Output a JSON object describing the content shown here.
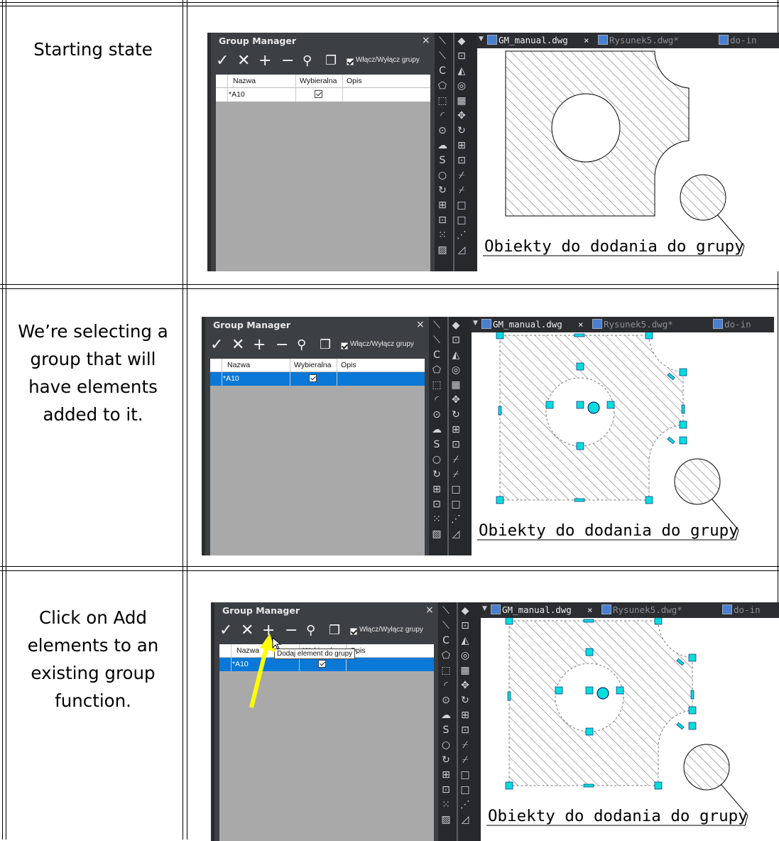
{
  "rows": [
    {
      "caption": "Starting state"
    },
    {
      "caption": "We’re selecting a group that will have elements added to it."
    },
    {
      "caption": "Click on Add elements to an existing group function."
    }
  ],
  "group_manager": {
    "title": "Group Manager",
    "close": "×",
    "toolbar": {
      "apply": "✓",
      "delete": "✕",
      "add": "+",
      "remove": "−",
      "search": "⚲",
      "copy": "❐"
    },
    "toggle_label": "Włącz/Wyłącz grupy",
    "columns": [
      "Nazwa",
      "Wybieralna",
      "Opis"
    ],
    "group_name": "*A10"
  },
  "tabs": [
    "GM_manual.dwg",
    "Rysunek5.dwg*",
    "do-in"
  ],
  "tab_close": "×",
  "drawing_label": "Obiekty do dodania do grupy",
  "tooltip": "Dodaj element do grupy",
  "colors": {
    "grip": "#00dede",
    "selection": "#0a78d7",
    "panel": "#3c3f44",
    "arrow": "#ffff00"
  }
}
